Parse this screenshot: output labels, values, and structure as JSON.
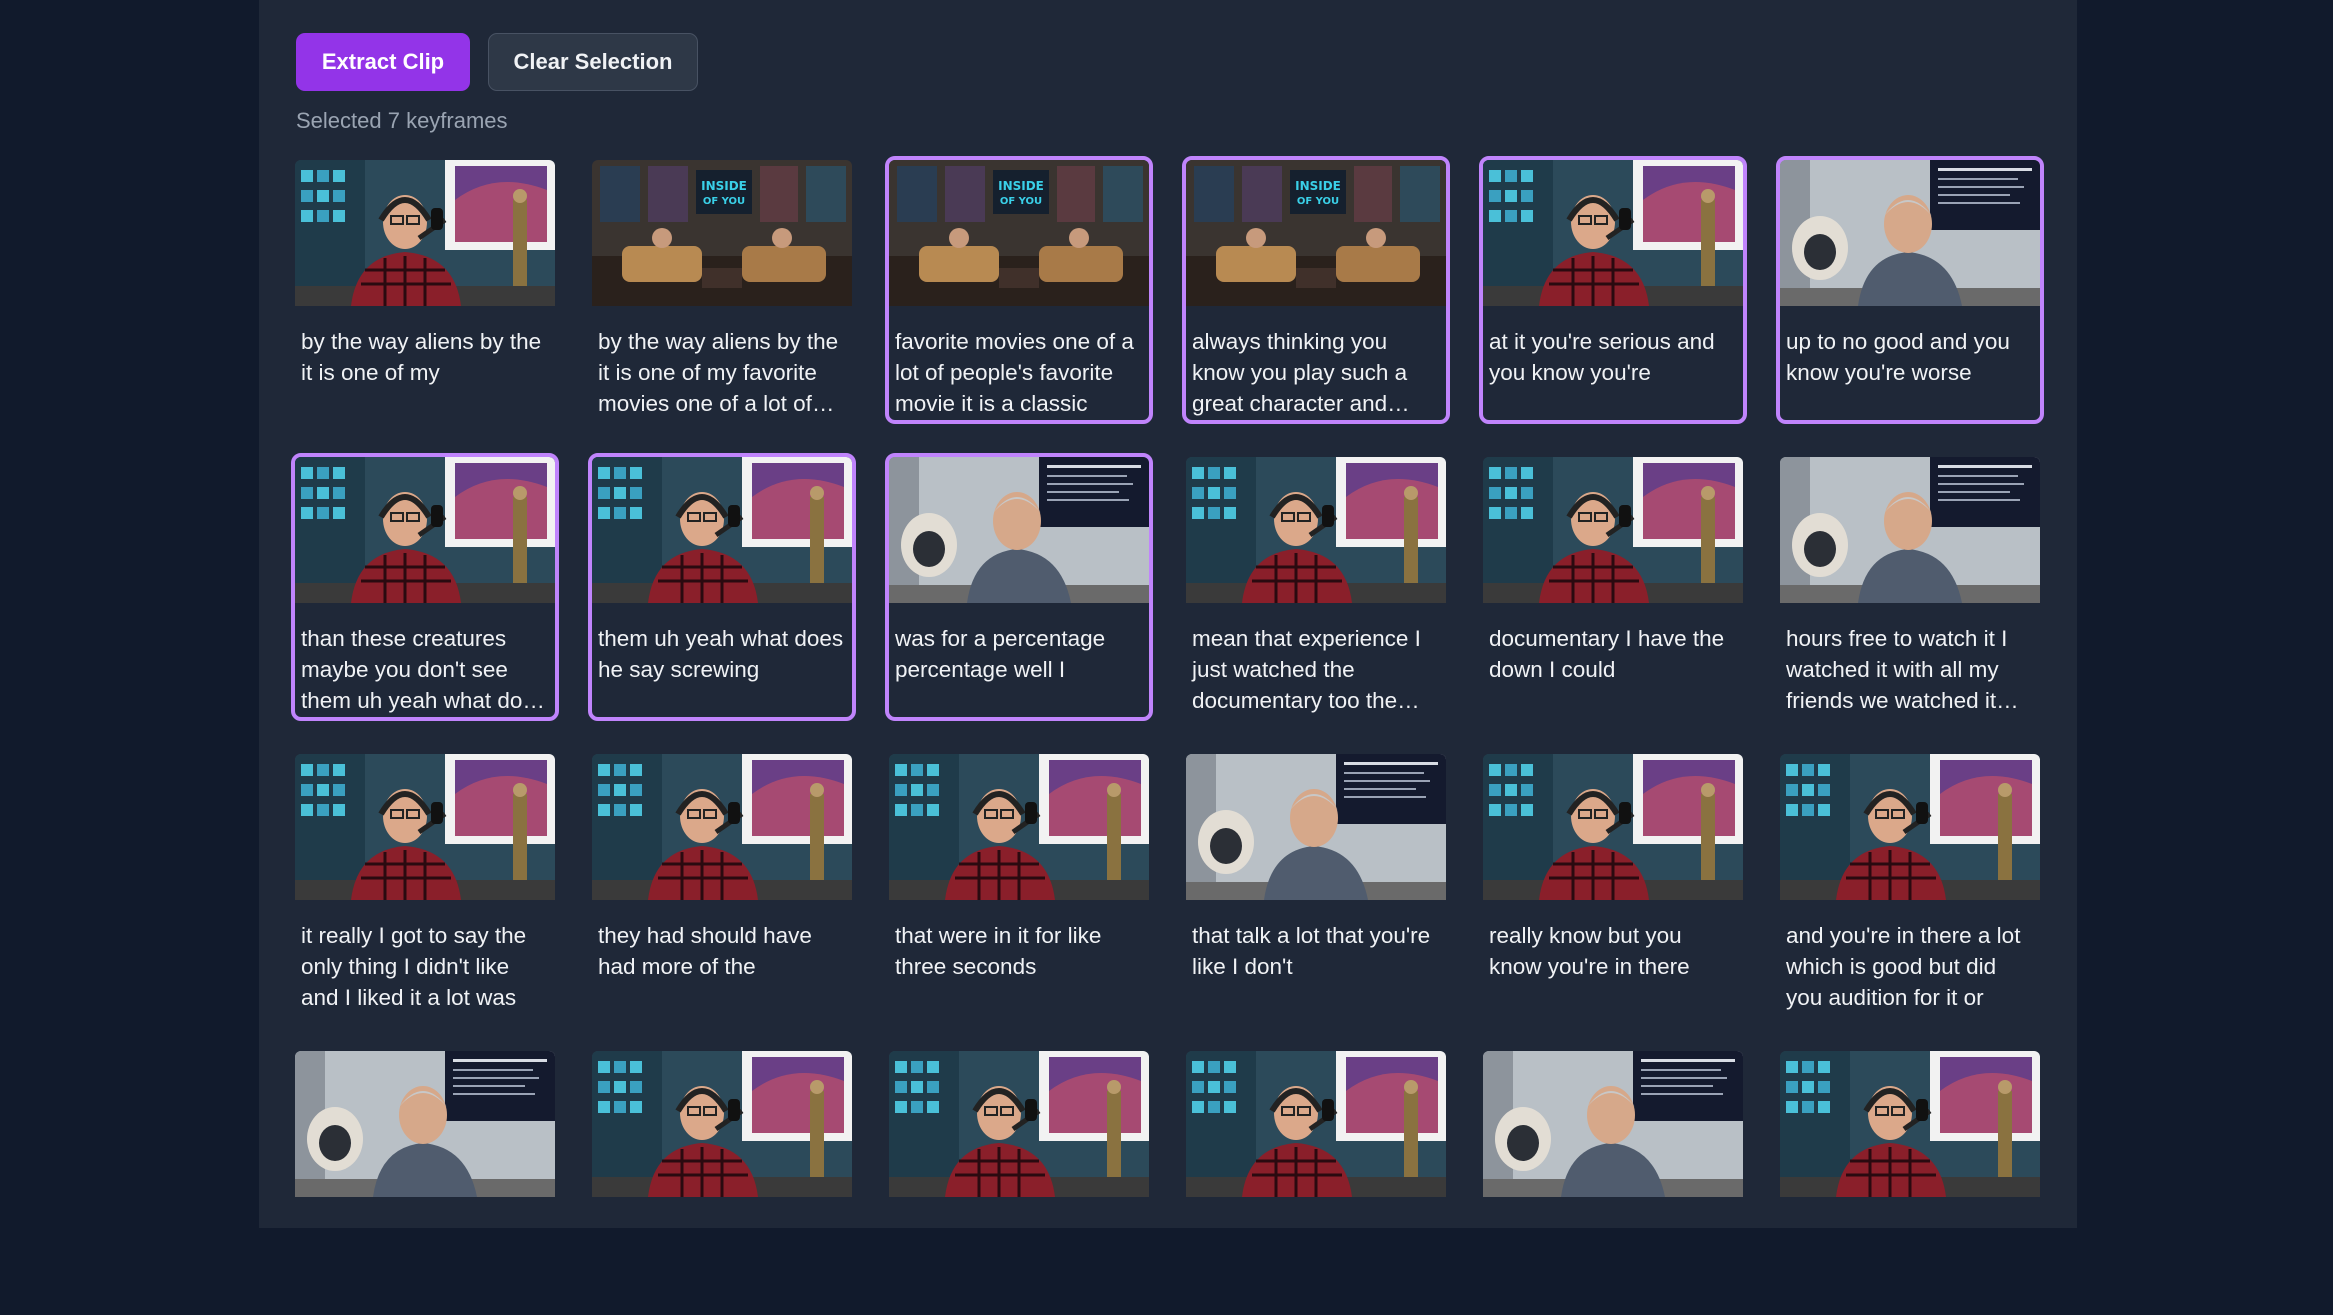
{
  "toolbar": {
    "extract_label": "Extract Clip",
    "clear_label": "Clear Selection"
  },
  "status": "Selected 7 keyframes",
  "keyframes": [
    {
      "caption": "by the way aliens by the it is one of my",
      "scene": "host",
      "selected": false
    },
    {
      "caption": "by the way aliens by the it is one of my favorite movies one of a lot of people's",
      "scene": "wide",
      "selected": false
    },
    {
      "caption": "favorite movies one of a lot of people's favorite movie it is a classic",
      "scene": "wide",
      "selected": true
    },
    {
      "caption": "always thinking you know you play such a great character and you're",
      "scene": "wide",
      "selected": true
    },
    {
      "caption": "at it you're serious and you know you're",
      "scene": "host",
      "selected": true
    },
    {
      "caption": "up to no good and you know you're worse",
      "scene": "guest",
      "selected": true
    },
    {
      "caption": "than these creatures maybe you don't see them uh yeah what does he say",
      "scene": "host",
      "selected": true
    },
    {
      "caption": "them uh yeah what does he say screwing",
      "scene": "host",
      "selected": true
    },
    {
      "caption": "was for a percentage percentage well I",
      "scene": "guest",
      "selected": true
    },
    {
      "caption": "mean that experience I just watched the documentary too the other day",
      "scene": "host",
      "selected": false
    },
    {
      "caption": "documentary I have the down I could",
      "scene": "host",
      "selected": false
    },
    {
      "caption": "hours free to watch it I watched it with all my friends we watched it together",
      "scene": "guest",
      "selected": false
    },
    {
      "caption": "it really I got to say the only thing I didn't like and I liked it a lot was",
      "scene": "host",
      "selected": false
    },
    {
      "caption": "they had should have had more of the",
      "scene": "host",
      "selected": false
    },
    {
      "caption": "that were in it for like three seconds",
      "scene": "host",
      "selected": false
    },
    {
      "caption": "that talk a lot that you're like I don't",
      "scene": "guest",
      "selected": false
    },
    {
      "caption": "really know but you know you're in there",
      "scene": "host",
      "selected": false
    },
    {
      "caption": "and you're in there a lot which is good but did you audition for it or",
      "scene": "host",
      "selected": false
    },
    {
      "caption": "",
      "scene": "guest",
      "selected": false
    },
    {
      "caption": "",
      "scene": "host",
      "selected": false
    },
    {
      "caption": "",
      "scene": "host",
      "selected": false
    },
    {
      "caption": "",
      "scene": "host",
      "selected": false
    },
    {
      "caption": "",
      "scene": "guest",
      "selected": false
    },
    {
      "caption": "",
      "scene": "host",
      "selected": false
    }
  ],
  "colors": {
    "accent": "#9334e8",
    "selected_border": "#c084fc",
    "panel": "#1f2838",
    "background": "#111a2c"
  }
}
